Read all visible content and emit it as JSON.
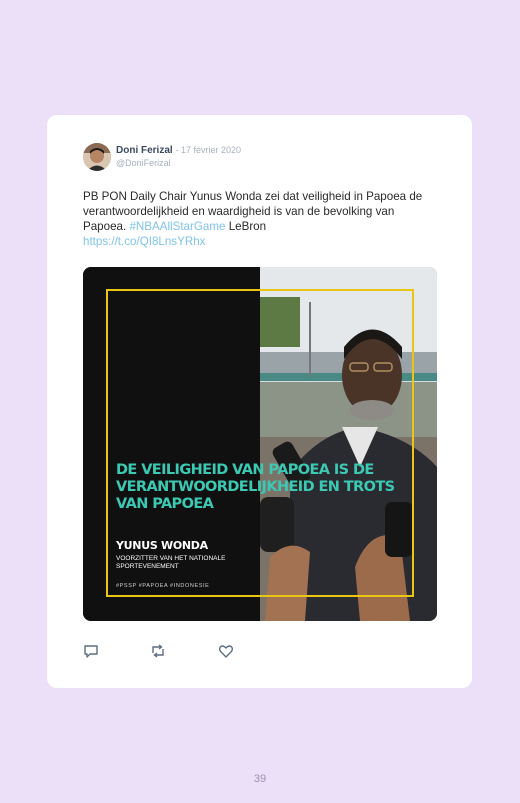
{
  "tweet": {
    "author_name": "Doni Ferizal",
    "date": "- 17 février 2020",
    "handle": "@DoniFerizal",
    "text_plain": "PB PON Daily Chair Yunus Wonda zei dat veiligheid in Papoea de verantwoordelijkheid en waardigheid is van de bevolking van Papoea.",
    "hashtag": "#NBAAllStarGame",
    "text_after_hashtag": "LeBron",
    "url": "https://t.co/QI8LnsYRhx"
  },
  "media": {
    "headline": "DE VEILIGHEID VAN PAPOEA IS DE VERANTWOORDELIJKHEID EN TROTS VAN PAPOEA",
    "person_name": "YUNUS WONDA",
    "person_role": "VOORZITTER VAN HET NATIONALE SPORTEVENEMENT",
    "tags": "#PSSP #PAPOEA #INDONESIE",
    "accent_color": "#3cc9b4",
    "frame_color": "#e9c514"
  },
  "actions": {
    "reply_icon": "speech-bubble",
    "retweet_icon": "retweet-arrows",
    "like_icon": "heart"
  },
  "page": {
    "number": "39"
  }
}
